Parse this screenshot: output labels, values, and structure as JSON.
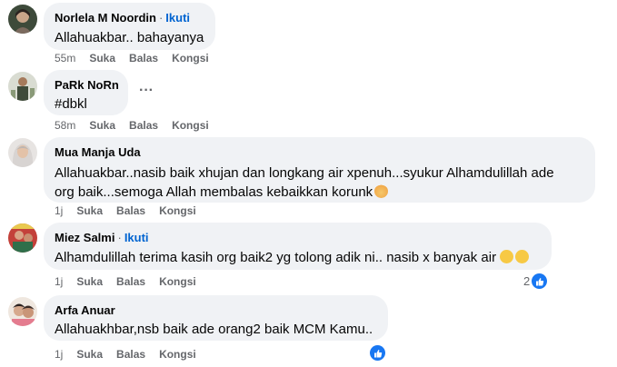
{
  "comments": [
    {
      "name": "Norlela M Noordin",
      "follow": "Ikuti",
      "text": "Allahuakbar.. bahayanya",
      "time": "55m",
      "like": "Suka",
      "reply": "Balas",
      "share": "Kongsi"
    },
    {
      "name": "PaRk NoRn",
      "text": "#dbkl",
      "time": "58m",
      "like": "Suka",
      "reply": "Balas",
      "share": "Kongsi",
      "more": "···"
    },
    {
      "name": "Mua Manja Uda",
      "text_line1": "Allahuakbar..nasib baik xhujan dan longkang air xpenuh...syukur Alhamdulillah ade",
      "text_line2": "org baik...semoga Allah membalas kebaikkan korunk",
      "time": "1j",
      "like": "Suka",
      "reply": "Balas",
      "share": "Kongsi"
    },
    {
      "name": "Miez Salmi",
      "follow": "Ikuti",
      "text": "Alhamdulillah terima kasih org baik2 yg tolong adik ni.. nasib x banyak air",
      "time": "1j",
      "like": "Suka",
      "reply": "Balas",
      "share": "Kongsi",
      "reaction_count": "2"
    },
    {
      "name": "Arfa Anuar",
      "text": "Allahuakhbar,nsb baik ade orang2 baik MCM Kamu..",
      "time": "1j",
      "like": "Suka",
      "reply": "Balas",
      "share": "Kongsi"
    }
  ],
  "colors": {
    "bubble": "#f0f2f5",
    "secondary_text": "#65676b",
    "follow_link": "#0064d1",
    "like_blue": "#1877f2"
  }
}
